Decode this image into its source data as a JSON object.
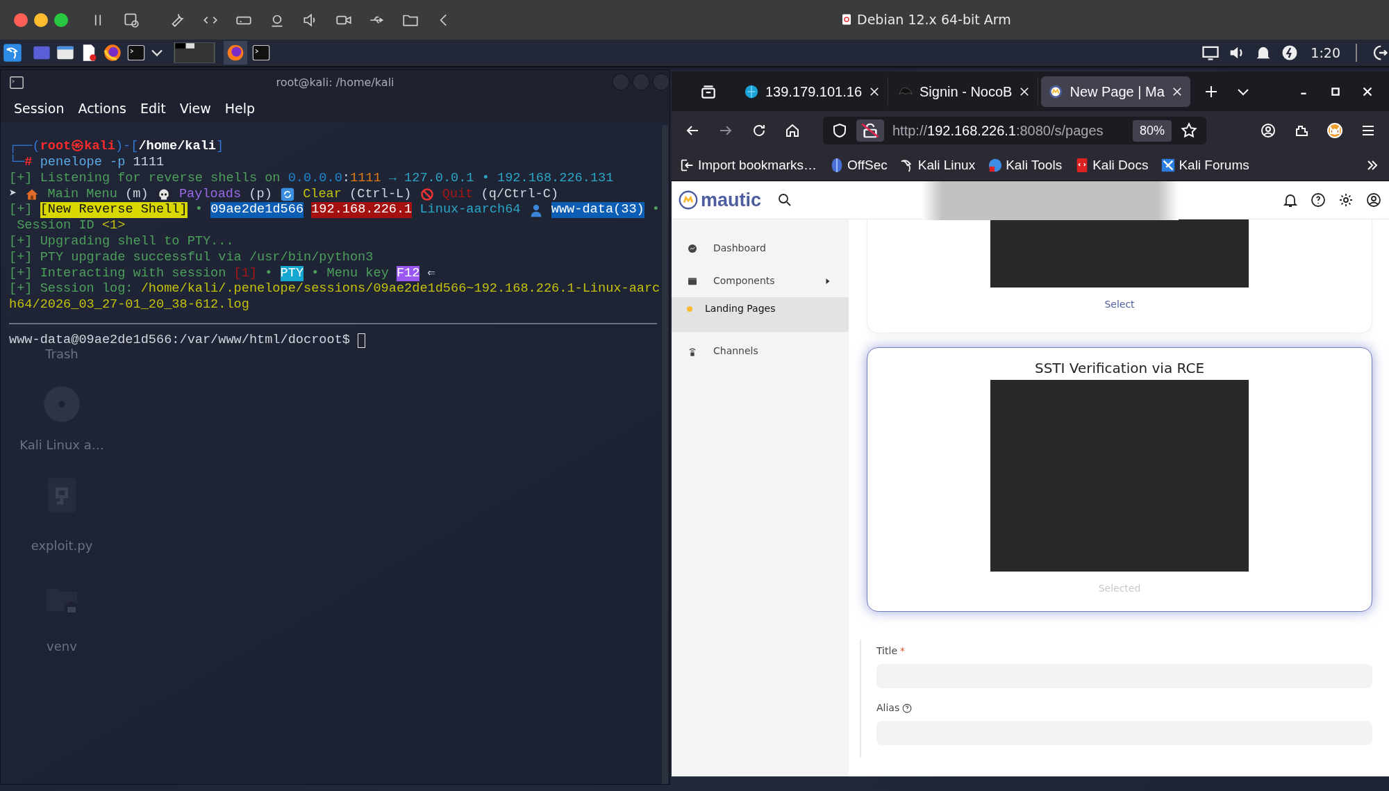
{
  "host_window": {
    "title": "Debian 12.x 64-bit Arm"
  },
  "taskbar": {
    "clock": "1:20"
  },
  "desktop_icons": [
    {
      "label": "Trash"
    },
    {
      "label": "Kali Linux a…"
    },
    {
      "label": "exploit.py"
    },
    {
      "label": "venv"
    }
  ],
  "terminal": {
    "title": "root@kali: /home/kali",
    "menu": [
      "Session",
      "Actions",
      "Edit",
      "View",
      "Help"
    ],
    "lines": [
      [
        {
          "text": "┌──(",
          "kind": "blue"
        },
        {
          "text": "root㉿kali",
          "kind": "redbold"
        },
        {
          "text": ")-[",
          "kind": "blue"
        },
        {
          "text": "/home/kali",
          "kind": "whitebold"
        },
        {
          "text": "]",
          "kind": "blue"
        }
      ],
      [
        {
          "text": "└─",
          "kind": "blue"
        },
        {
          "text": "#",
          "kind": "redbold"
        },
        {
          "text": " penelope -p",
          "kind": "cmd"
        },
        {
          "text": " 1111",
          "kind": "plain"
        }
      ],
      [
        {
          "text": "[+] Listening for reverse shells on ",
          "kind": "green"
        },
        {
          "text": "0.0.0.0",
          "kind": "ip"
        },
        {
          "text": ":",
          "kind": "plain"
        },
        {
          "text": "1111",
          "kind": "orange"
        },
        {
          "text": " → 127.0.0.1 • 192.168.226.131",
          "kind": "cyan"
        }
      ],
      [
        {
          "text": "➤ ",
          "kind": "plain"
        },
        {
          "kind": "icon"
        },
        {
          "text": " Main Menu",
          "kind": "green"
        },
        {
          "text": " (m) ",
          "kind": "plain"
        },
        {
          "kind": "icon"
        },
        {
          "text": " Payloads",
          "kind": "purple"
        },
        {
          "text": " (p) ",
          "kind": "plain"
        },
        {
          "kind": "icon"
        },
        {
          "text": " Clear",
          "kind": "yellow"
        },
        {
          "text": " (Ctrl-L) ",
          "kind": "plain"
        },
        {
          "kind": "icon"
        },
        {
          "text": " Quit",
          "kind": "darkred"
        },
        {
          "text": " (q/Ctrl-C)",
          "kind": "plain"
        }
      ],
      [
        {
          "text": "[+] ",
          "kind": "green"
        },
        {
          "text": "[New Reverse Shell]",
          "kind": "tagyellow"
        },
        {
          "text": " • ",
          "kind": "green"
        },
        {
          "text": "09ae2de1d566",
          "kind": "tagblue"
        },
        {
          "text": "192.168.226.1",
          "kind": "tagred"
        },
        {
          "text": " Linux-aarch64 ",
          "kind": "cyan"
        },
        {
          "kind": "icon"
        },
        {
          "text": "www-data(33)",
          "kind": "tagblue"
        },
        {
          "text": " •",
          "kind": "green"
        }
      ],
      [
        {
          "text": " Session ID ",
          "kind": "green"
        },
        {
          "text": "<1>",
          "kind": "yellow"
        }
      ],
      [
        {
          "text": "[+] Upgrading shell to PTY...",
          "kind": "green"
        }
      ],
      [
        {
          "text": "[+] PTY upgrade successful via /usr/bin/python3",
          "kind": "green"
        }
      ],
      [
        {
          "text": "[+] Interacting with session ",
          "kind": "green"
        },
        {
          "text": "[1]",
          "kind": "darkred"
        },
        {
          "text": " • ",
          "kind": "green"
        },
        {
          "text": "PTY",
          "kind": "tagcyan"
        },
        {
          "text": " • Menu key ",
          "kind": "green"
        },
        {
          "text": "F12",
          "kind": "tagpurple"
        },
        {
          "text": " ⇐",
          "kind": "plain"
        }
      ],
      [
        {
          "text": "[+] Session log: ",
          "kind": "green"
        },
        {
          "text": "/home/kali/.penelope/sessions/09ae2de1d566~192.168.226.1-Linux-aarc",
          "kind": "yellow"
        }
      ],
      [
        {
          "text": "h64/2026_03_27-01_20_38-612.log",
          "kind": "yellow"
        }
      ]
    ],
    "prompt": "www-data@09ae2de1d566:/var/www/html/docroot$"
  },
  "browser": {
    "tabs": [
      {
        "title": "139.179.101.16",
        "selected": false
      },
      {
        "title": "Signin - NocoB",
        "selected": false
      },
      {
        "title": "New Page | Ma",
        "selected": true
      }
    ],
    "url": {
      "scheme": "http://",
      "host": "192.168.226.1",
      "path": ":8080/s/pages"
    },
    "zoom": "80%",
    "bookmarks": [
      "Import bookmarks…",
      "OffSec",
      "Kali Linux",
      "Kali Tools",
      "Kali Docs",
      "Kali Forums"
    ]
  },
  "mautic": {
    "logo": "mautic",
    "sidebar": [
      {
        "label": "Dashboard",
        "selected": false,
        "expandable": false
      },
      {
        "label": "Components",
        "selected": false,
        "expandable": true
      },
      {
        "label": "Landing Pages",
        "selected": true,
        "expandable": false
      },
      {
        "label": "Channels",
        "selected": false,
        "expandable": false
      }
    ],
    "themes": [
      {
        "action": "Select",
        "selected": false
      },
      {
        "title": "SSTI Verification via RCE",
        "action": "Selected",
        "selected": true
      }
    ],
    "form": [
      {
        "label": "Title",
        "required_mark": "*"
      },
      {
        "label": "Alias",
        "help": true
      }
    ]
  }
}
